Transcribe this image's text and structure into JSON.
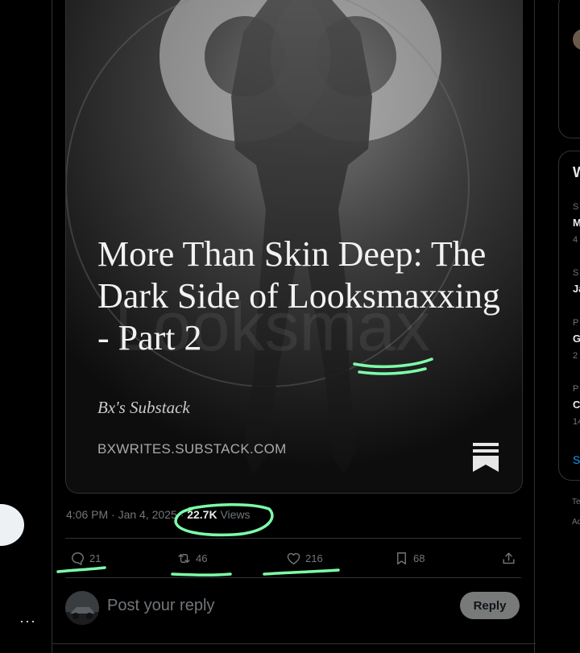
{
  "sidebar_left": {
    "more_label": "···"
  },
  "post": {
    "card": {
      "title": "More Than Skin Deep: The Dark Side of Looksmaxxing - Part 2",
      "byline": "Bx's Substack",
      "domain": "BXWRITES.SUBSTACK.COM",
      "watermark_text": "Looksmax",
      "logo_icon": "substack-bookmark-icon"
    },
    "meta": {
      "time": "4:06 PM",
      "separator": "·",
      "date": "Jan 4, 2025",
      "views_count": "22.7K",
      "views_label": "Views"
    },
    "actions": {
      "replies": "21",
      "reposts": "46",
      "likes": "216",
      "bookmarks": "68"
    }
  },
  "reply_composer": {
    "placeholder": "Post your reply",
    "button_label": "Reply"
  },
  "sidebar_right": {
    "partial_texts": {
      "w": "W",
      "s1": "S",
      "m": "M",
      "n4": "4",
      "s2": "S",
      "ja": "Ja",
      "p1": "P",
      "g": "G",
      "n2": "2",
      "p2": "P",
      "c": "C",
      "n14": "14",
      "s_link": "S",
      "te": "Te",
      "ac": "Ac"
    }
  },
  "colors": {
    "background": "#000000",
    "text_primary": "#e7e9ea",
    "text_secondary": "#71767b",
    "border": "#2f3336",
    "link_blue": "#1d9bf0",
    "highlight_marker": "#7dffa8"
  }
}
